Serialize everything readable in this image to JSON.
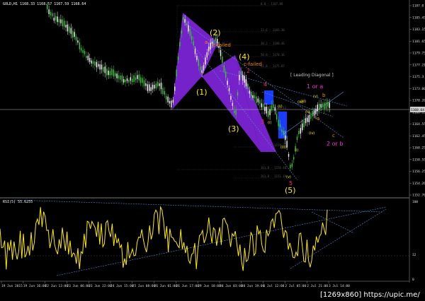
{
  "chart_header": {
    "symbol_info": "GOLD,H1  1168.33  1168.57  1167.59  1168.64",
    "indicator_info": "RSI(5) 55.6255"
  },
  "price_axis": {
    "ticks": [
      "1187.0",
      "1185.45",
      "1183.15",
      "1181.65",
      "1179.75",
      "1177.21",
      "1175.3",
      "1173.00",
      "1170.20",
      "1166.15",
      "1164.55",
      "1162.45",
      "1160.25",
      "1158.55",
      "1156.25",
      "1154.26",
      "1152.70"
    ],
    "current_price": "1168.64"
  },
  "rsi_axis": {
    "ticks": [
      "100",
      "32",
      "0"
    ]
  },
  "time_axis": {
    "ticks": [
      "19 Jun 2015",
      "19 Jun 16:00",
      "22 Jun 13:00",
      "23 Jun 06:00",
      "23 Jun 22:00",
      "24 Jun 15:00",
      "25 Jun 08:00",
      "26 Jun 01:00",
      "26 Jun 17:00",
      "29 Jun 10:00",
      "30 Jun 03:00",
      "30 Jun 19:00",
      "1 Jul 12:00",
      "2 Jul 05:00",
      "2 Jul 21:00",
      "3 Jul 14:00"
    ]
  },
  "fib_levels": [
    "0.0 - 1187.89",
    "23.6 - 1183.30",
    "38.2 - 1180.46",
    "50.0 - 1178.16",
    "61.8 - 1175.87",
    "100.0 - 1168.43",
    "161.8 - 1156.40",
    "100.0 - 1167.31",
    "161.8 - 1159.38",
    "261.8 - 1151.19"
  ],
  "wave_labels": {
    "w1": "(1)",
    "w2": "(2)",
    "w3": "(3)",
    "w4": "(4)",
    "w5": "(5)",
    "a": "a",
    "c_failed_1": "c-failed",
    "c_failed_2": "c-failed",
    "r3": "3",
    "r4": "4",
    "r5": "5",
    "r2": "2",
    "one_or_a": "1 or a",
    "two_or_b": "2 or b",
    "sub_i": "(i)",
    "sub_ii": "(ii)",
    "sub_iii": "(iii)",
    "sub_iv": "(iv)",
    "sub_v": "(v)",
    "small_i": "(i)",
    "small_ii": "(ii)",
    "small_iii": "(iii)",
    "small_iv": "(iv)",
    "small_v": "(v)",
    "b": "b",
    "c": "c",
    "a2": "a",
    "leading_diagonal": "[ Leading Diagonal ]"
  },
  "watermark": "[1269x860] https://upic.me/",
  "colors": {
    "background": "#000000",
    "bull_candle": "#32cd32",
    "bear_candle": "#ffffff",
    "harmonic_fill": "#7b24d6",
    "rsi_line": "#ffeb00",
    "trend_line": "#5c8ed0",
    "price_highlight": "#1a3cff"
  }
}
